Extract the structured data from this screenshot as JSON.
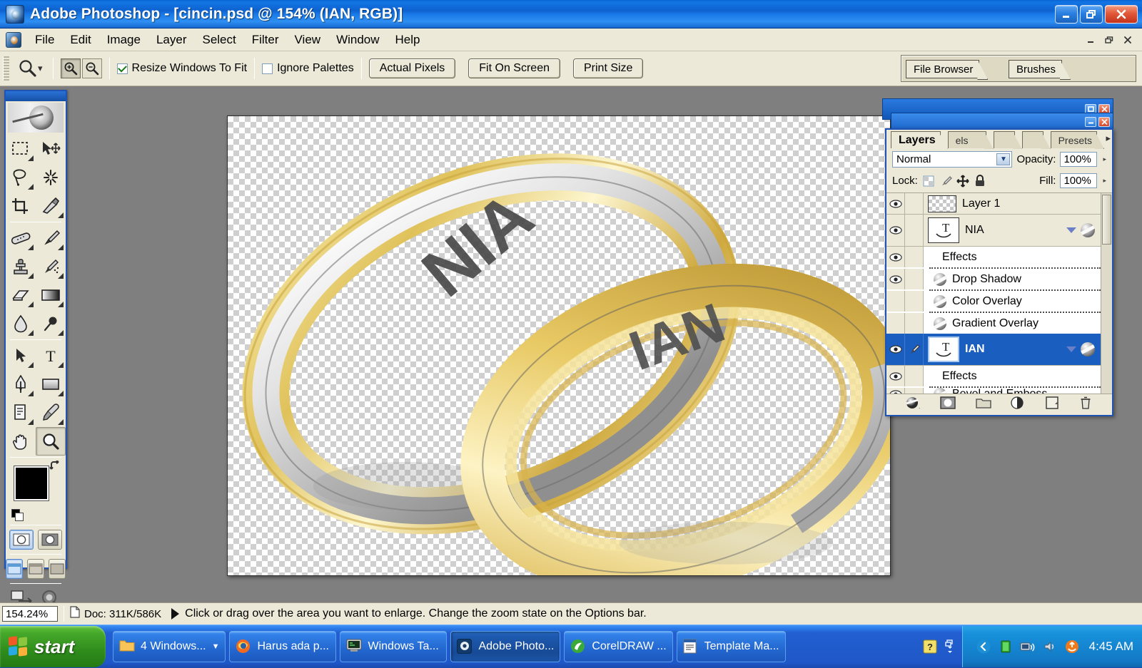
{
  "window": {
    "app_name": "Adobe Photoshop",
    "title": "Adobe Photoshop - [cincin.psd @ 154% (IAN, RGB)]",
    "document_name": "cincin.psd",
    "zoom_label": "154%",
    "layer_label": "IAN",
    "color_mode": "RGB",
    "minimize_label": "Minimize",
    "restore_label": "Restore",
    "close_label": "Close"
  },
  "menubar": {
    "items": [
      {
        "label": "File"
      },
      {
        "label": "Edit"
      },
      {
        "label": "Image"
      },
      {
        "label": "Layer"
      },
      {
        "label": "Select"
      },
      {
        "label": "Filter"
      },
      {
        "label": "View"
      },
      {
        "label": "Window"
      },
      {
        "label": "Help"
      }
    ],
    "mdi": {
      "minimize": "_",
      "restore": "❐",
      "close": "✕"
    }
  },
  "options_bar": {
    "current_tool": "zoom-tool",
    "zoom_in_label": "Zoom In",
    "zoom_out_label": "Zoom Out",
    "resize_windows": {
      "label": "Resize Windows To Fit",
      "checked": true
    },
    "ignore_palettes": {
      "label": "Ignore Palettes",
      "checked": false
    },
    "buttons": [
      {
        "label": "Actual Pixels"
      },
      {
        "label": "Fit On Screen"
      },
      {
        "label": "Print Size"
      }
    ],
    "palette_well": [
      {
        "label": "File Browser"
      },
      {
        "label": "Brushes"
      }
    ]
  },
  "toolbox": {
    "tools": [
      {
        "name": "rectangular-marquee-tool",
        "glyph": "marquee",
        "has_flyout": true,
        "selected": false
      },
      {
        "name": "move-tool",
        "glyph": "move",
        "has_flyout": false,
        "selected": false
      },
      {
        "name": "lasso-tool",
        "glyph": "lasso",
        "has_flyout": true,
        "selected": false
      },
      {
        "name": "magic-wand-tool",
        "glyph": "wand",
        "has_flyout": false,
        "selected": false
      },
      {
        "name": "crop-tool",
        "glyph": "crop",
        "has_flyout": false,
        "selected": false
      },
      {
        "name": "slice-tool",
        "glyph": "slice",
        "has_flyout": true,
        "selected": false
      },
      {
        "name": "healing-brush-tool",
        "glyph": "healing",
        "has_flyout": true,
        "selected": false
      },
      {
        "name": "brush-tool",
        "glyph": "brush",
        "has_flyout": true,
        "selected": false
      },
      {
        "name": "clone-stamp-tool",
        "glyph": "stamp",
        "has_flyout": true,
        "selected": false
      },
      {
        "name": "history-brush-tool",
        "glyph": "historybrush",
        "has_flyout": true,
        "selected": false
      },
      {
        "name": "eraser-tool",
        "glyph": "eraser",
        "has_flyout": true,
        "selected": false
      },
      {
        "name": "gradient-tool",
        "glyph": "gradient",
        "has_flyout": true,
        "selected": false
      },
      {
        "name": "blur-tool",
        "glyph": "blur",
        "has_flyout": true,
        "selected": false
      },
      {
        "name": "dodge-tool",
        "glyph": "dodge",
        "has_flyout": true,
        "selected": false
      },
      {
        "name": "path-selection-tool",
        "glyph": "pathsel",
        "has_flyout": true,
        "selected": false
      },
      {
        "name": "type-tool",
        "glyph": "type",
        "has_flyout": true,
        "selected": false
      },
      {
        "name": "pen-tool",
        "glyph": "pen",
        "has_flyout": true,
        "selected": false
      },
      {
        "name": "rectangle-shape-tool",
        "glyph": "shape",
        "has_flyout": true,
        "selected": false
      },
      {
        "name": "notes-tool",
        "glyph": "notes",
        "has_flyout": true,
        "selected": false
      },
      {
        "name": "eyedropper-tool",
        "glyph": "eyedropper",
        "has_flyout": true,
        "selected": false
      },
      {
        "name": "hand-tool",
        "glyph": "hand",
        "has_flyout": false,
        "selected": false
      },
      {
        "name": "zoom-tool",
        "glyph": "zoom",
        "has_flyout": false,
        "selected": true
      }
    ],
    "foreground_color": "#000000",
    "background_color": "#ffffff",
    "quick_mask": {
      "standard_selected": true
    },
    "screen_modes": {
      "standard_selected": true
    },
    "jump_to_imageready_label": "Jump To ImageReady"
  },
  "document": {
    "engraving_left": "NIA",
    "engraving_right": "IAN",
    "background": "transparent-checkerboard"
  },
  "layers_palette": {
    "tabs": [
      {
        "label": "Layers",
        "active": true
      },
      {
        "label": "els",
        "active": false
      },
      {
        "label": "",
        "active": false
      },
      {
        "label": "",
        "active": false
      },
      {
        "label": "Presets",
        "active": false
      }
    ],
    "blend_mode": "Normal",
    "opacity_label": "Opacity:",
    "opacity_value": "100%",
    "lock_label": "Lock:",
    "fill_label": "Fill:",
    "fill_value": "100%",
    "lock_icons": [
      {
        "name": "lock-transparency-icon"
      },
      {
        "name": "lock-image-pixels-icon"
      },
      {
        "name": "lock-position-icon"
      },
      {
        "name": "lock-all-icon"
      }
    ],
    "rows": [
      {
        "type": "layer",
        "name": "Layer 1",
        "visible": true,
        "linked": false,
        "selected": false,
        "thumb": "checker",
        "has_fx": false
      },
      {
        "type": "layer",
        "name": "NIA",
        "visible": true,
        "linked": false,
        "selected": false,
        "thumb": "type",
        "has_fx": true
      },
      {
        "type": "effects-header",
        "name": "Effects",
        "visible": true
      },
      {
        "type": "effect",
        "name": "Drop Shadow",
        "visible": true
      },
      {
        "type": "effect",
        "name": "Color Overlay",
        "visible": false
      },
      {
        "type": "effect",
        "name": "Gradient Overlay",
        "visible": false
      },
      {
        "type": "layer",
        "name": "IAN",
        "visible": true,
        "linked": true,
        "selected": true,
        "thumb": "type",
        "has_fx": true
      },
      {
        "type": "effects-header",
        "name": "Effects",
        "visible": true
      },
      {
        "type": "effect",
        "name": "Bevel and Emboss",
        "visible": true
      }
    ],
    "footer_buttons": [
      {
        "name": "add-layer-style-button",
        "label": "Add a layer style"
      },
      {
        "name": "add-layer-mask-button",
        "label": "Add layer mask"
      },
      {
        "name": "new-group-button",
        "label": "Create a new set"
      },
      {
        "name": "new-adjustment-layer-button",
        "label": "Create new fill or adjustment layer"
      },
      {
        "name": "new-layer-button",
        "label": "Create a new layer"
      },
      {
        "name": "delete-layer-button",
        "label": "Delete layer"
      }
    ]
  },
  "status_bar": {
    "zoom_value": "154.24%",
    "doc_info": "Doc: 311K/586K",
    "hint": "Click or drag over the area you want to enlarge. Change the zoom state on the Options bar."
  },
  "taskbar": {
    "start_label": "start",
    "items": [
      {
        "label": "4 Windows...",
        "icon": "folder-icon",
        "active": false,
        "has_caret": true
      },
      {
        "label": "Harus ada p...",
        "icon": "firefox-icon",
        "active": false,
        "has_caret": false
      },
      {
        "label": "Windows Ta...",
        "icon": "console-icon",
        "active": false,
        "has_caret": false
      },
      {
        "label": "Adobe Photo...",
        "icon": "photoshop-icon",
        "active": true,
        "has_caret": false
      },
      {
        "label": "CorelDRAW ...",
        "icon": "coreldraw-icon",
        "active": false,
        "has_caret": false
      },
      {
        "label": "Template Ma...",
        "icon": "word-icon",
        "active": false,
        "has_caret": false
      }
    ],
    "notify_icons": [
      {
        "name": "help-icon"
      },
      {
        "name": "network-overflow-icon"
      },
      {
        "name": "show-hidden-icons-button"
      },
      {
        "name": "battery-icon"
      },
      {
        "name": "wireless-network-icon"
      },
      {
        "name": "volume-icon"
      },
      {
        "name": "update-icon"
      }
    ],
    "clock": "4:45 AM"
  },
  "colors": {
    "titlebar_blue": "#1275e4",
    "panel_bg": "#ece9d8",
    "selection_blue": "#1a5fc0",
    "taskbar_blue": "#225fd0",
    "start_green": "#2f8c1c",
    "close_red": "#c3331a"
  }
}
